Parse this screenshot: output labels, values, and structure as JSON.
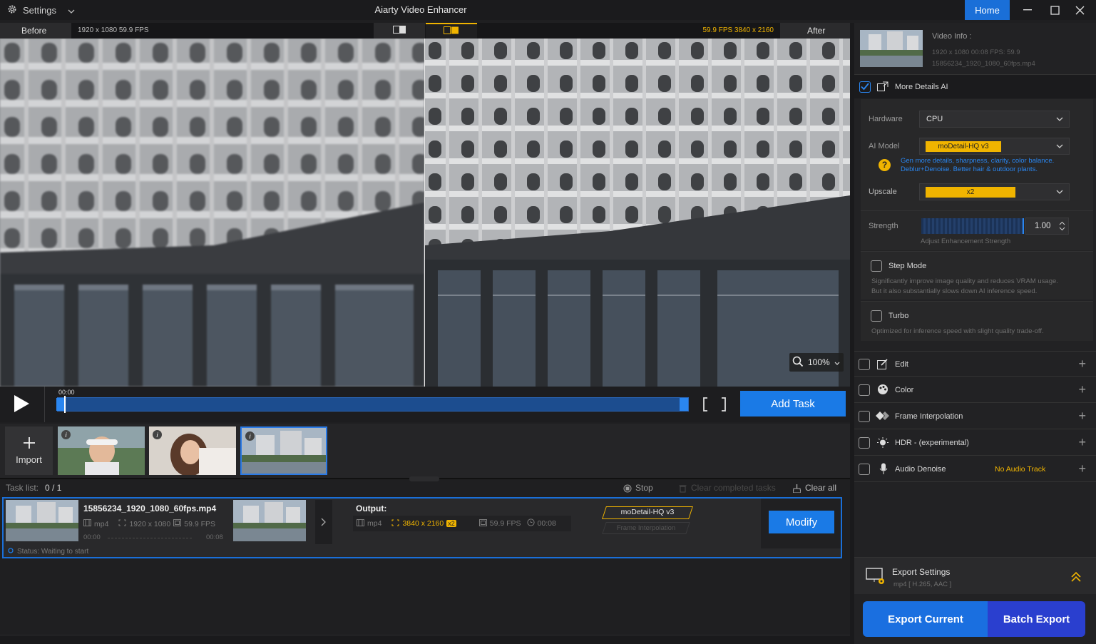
{
  "titlebar": {
    "settings_label": "Settings",
    "app_title": "Aiarty Video Enhancer",
    "home_label": "Home"
  },
  "compare": {
    "before_label": "Before",
    "after_label": "After",
    "before_info": "1920 x 1080  59.9 FPS",
    "after_info": "59.9 FPS  3840 x 2160"
  },
  "preview": {
    "zoom": "100%"
  },
  "timeline": {
    "time": "00:00",
    "add_task_label": "Add Task"
  },
  "strip": {
    "import_label": "Import"
  },
  "tasklist": {
    "label": "Task list:",
    "count": "0 / 1",
    "stop_label": "Stop",
    "clear_completed_label": "Clear completed tasks",
    "clear_all_label": "Clear all"
  },
  "task": {
    "filename": "15856234_1920_1080_60fps.mp4",
    "format": "mp4",
    "resolution": "1920 x 1080",
    "fps": "59.9 FPS",
    "start_time": "00:00",
    "end_time": "00:08",
    "status": "Status: Waiting to start",
    "output_label": "Output:",
    "output_format": "mp4",
    "output_resolution": "3840 x 2160",
    "output_scale": "x2",
    "output_fps": "59.9 FPS",
    "output_duration": "00:08",
    "model_tag": "moDetail-HQ  v3",
    "frame_tag": "Frame Interpolation",
    "modify_label": "Modify"
  },
  "panel": {
    "video_info_title": "Video Info :",
    "video_info_line": "1920 x 1080  00:08     FPS: 59.9",
    "video_info_file": "15856234_1920_1080_60fps.mp4",
    "more_details_label": "More Details AI",
    "hardware_label": "Hardware",
    "hardware_value": "CPU",
    "ai_model_label": "AI Model",
    "ai_model_value": "moDetail-HQ  v3",
    "model_help_1": "Gen more details, sharpness, clarity, color balance.",
    "model_help_2": "Deblur+Denoise. Better hair & outdoor plants.",
    "upscale_label": "Upscale",
    "upscale_value": "x2",
    "strength_label": "Strength",
    "strength_value": "1.00",
    "strength_hint": "Adjust Enhancement Strength",
    "step_mode_label": "Step Mode",
    "step_mode_desc_1": "Significantly improve image quality and reduces VRAM usage.",
    "step_mode_desc_2": "But it also substantially slows down AI inference speed.",
    "turbo_label": "Turbo",
    "turbo_desc": "Optimized for inference speed with slight quality trade-off.",
    "edit_label": "Edit",
    "color_label": "Color",
    "frame_interp_label": "Frame Interpolation",
    "hdr_label": "HDR - (experimental)",
    "audio_denoise_label": "Audio Denoise",
    "no_audio_label": "No Audio Track",
    "export_settings_label": "Export Settings",
    "export_settings_value": "mp4 [ H.265, AAC ]",
    "export_current_label": "Export Current",
    "batch_export_label": "Batch Export"
  },
  "colors": {
    "accent": "#1a7ae6",
    "highlight": "#f0b400"
  }
}
